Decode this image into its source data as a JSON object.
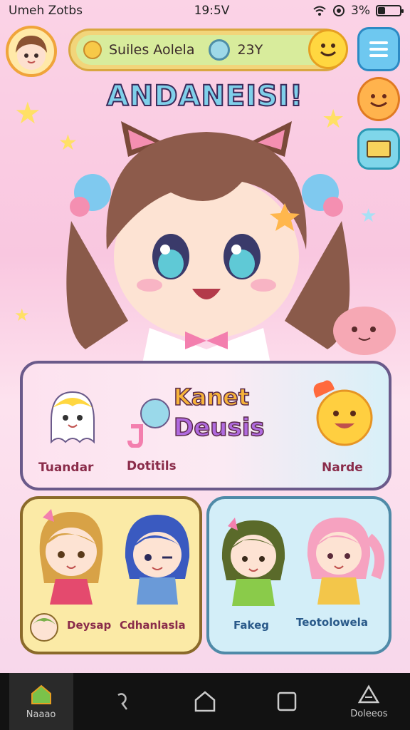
{
  "status_bar": {
    "left_text": "Umeh Zotbs",
    "time": "19:5V",
    "battery_pct": "3%",
    "battery_level": 0.33
  },
  "top_bar": {
    "label": "Suiles Aolela",
    "count": "23Y"
  },
  "game_title": "ANDANEISI!",
  "panel_top": {
    "title_line1": "Kanet",
    "title_line2": "Deusis",
    "item1_label": "Tuandar",
    "item2_label": "Dotitils",
    "item3_label": "Narde"
  },
  "panel_left": {
    "label1": "Deysap",
    "label2": "Cdhanlasla"
  },
  "panel_right": {
    "label1": "Fakeg",
    "label2": "Teotolowela"
  },
  "nav": {
    "home_label": "Naaao",
    "last_label": "Doleeos"
  },
  "colors": {
    "accent_pink": "#f37fae",
    "accent_blue": "#6ec8f0",
    "accent_yellow": "#ffd740"
  },
  "icons": [
    "wifi-icon",
    "signal-icon",
    "battery-icon",
    "menu-icon",
    "smile-icon",
    "chest-icon",
    "home-icon",
    "search-icon",
    "house-icon",
    "square-icon",
    "triangle-icon"
  ]
}
